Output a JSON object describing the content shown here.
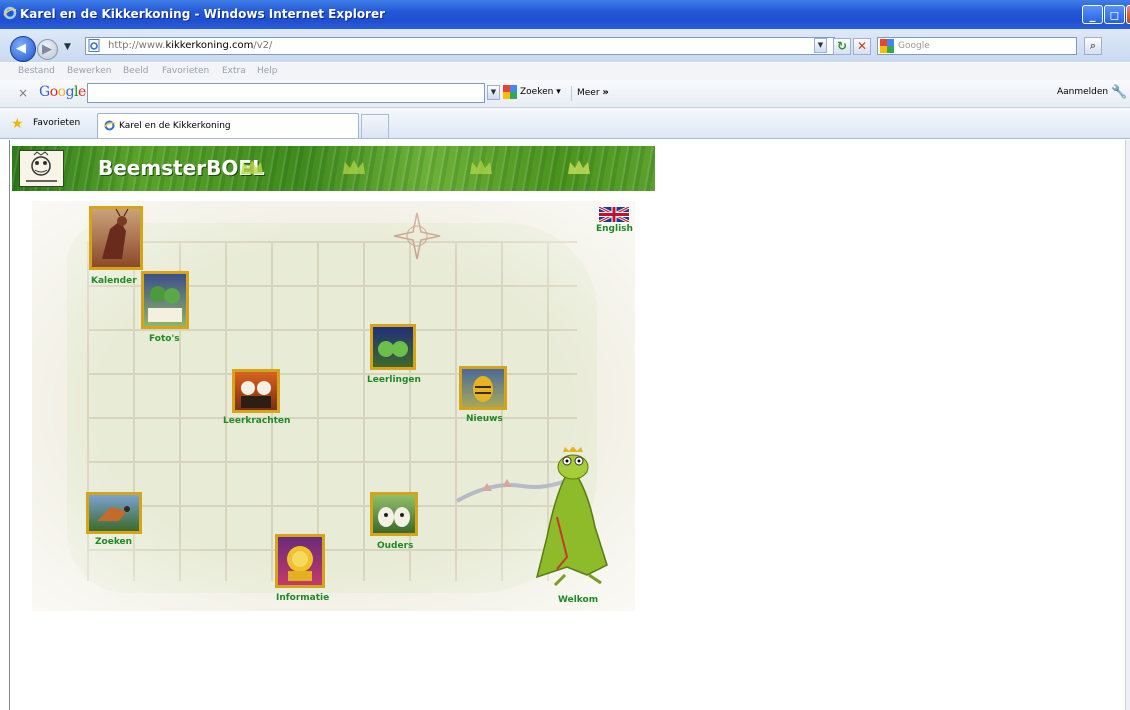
{
  "window": {
    "title": "Karel en de Kikkerkoning - Windows Internet Explorer"
  },
  "address": {
    "prefix": "http://www.",
    "domain": "kikkerkoning.com",
    "path": "/v2/"
  },
  "search": {
    "placeholder": "Google"
  },
  "menu": {
    "items": [
      "Bestand",
      "Bewerken",
      "Beeld",
      "Favorieten",
      "Extra",
      "Help"
    ]
  },
  "googlebar": {
    "close": "×",
    "logo": "Google",
    "zoeken": "Zoeken",
    "meer": "Meer",
    "aanmelden": "Aanmelden"
  },
  "favorites": {
    "label": "Favorieten",
    "tab_title": "Karel en de Kikkerkoning"
  },
  "page": {
    "banner_title": "BeemsterBOEL",
    "english": "English",
    "nav": {
      "kalender": "Kalender",
      "fotos": "Foto's",
      "leerlingen": "Leerlingen",
      "leerkrachten": "Leerkrachten",
      "nieuws": "Nieuws",
      "zoeken": "Zoeken",
      "ouders": "Ouders",
      "informatie": "Informatie",
      "welkom": "Welkom"
    }
  },
  "colors": {
    "titlebar": "#2458d8",
    "banner_green": "#4b931f",
    "label_green": "#1f8a24",
    "tile_gold": "#d6a419"
  }
}
